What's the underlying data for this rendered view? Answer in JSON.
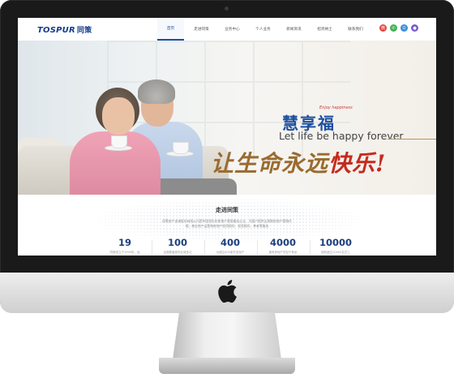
{
  "site": {
    "logo": "TOSPUR",
    "logo_cn": "同策"
  },
  "nav": {
    "items": [
      {
        "label": "首页",
        "active": true
      },
      {
        "label": "走进同策",
        "active": false
      },
      {
        "label": "业务中心",
        "active": false
      },
      {
        "label": "个人业务",
        "active": false
      },
      {
        "label": "新闻资讯",
        "active": false
      },
      {
        "label": "招贤纳士",
        "active": false
      },
      {
        "label": "联系我们",
        "active": false
      }
    ],
    "social_icons": [
      {
        "name": "weibo-icon",
        "color": "#e0453a",
        "glyph": "微"
      },
      {
        "name": "wechat-icon",
        "color": "#3fb34f",
        "glyph": "✆"
      },
      {
        "name": "qq-icon",
        "color": "#3a8ddb",
        "glyph": "Q"
      },
      {
        "name": "user-icon",
        "color": "#7b5cc9",
        "glyph": "●"
      }
    ]
  },
  "banner": {
    "brand_cn": "慧享福",
    "brand_script": "Enjoy happiness",
    "slogan_en": "Let life be happy forever",
    "slogan_cn_part1": "让生命永远",
    "slogan_cn_part2": "快乐!",
    "slide_count": 4,
    "active_slide": 3
  },
  "about": {
    "title": "走进同策",
    "description": "同策房产咨询股份有限公司是中国领先的房地产营销服务企业，为客户提供全周期房地产营销代理、商业地产运营和房地产投资顾问、投资顾问、养老等服务",
    "stats": [
      {
        "value": "19",
        "caption": "同策成立于1999年，经"
      },
      {
        "value": "100",
        "caption": "全国覆盖城市区域多达"
      },
      {
        "value": "400",
        "caption": "为超过400家开发商产"
      },
      {
        "value": "4000",
        "caption": "拥有房地产项目千条余"
      },
      {
        "value": "10000",
        "caption": "拥有超过10000名员工"
      }
    ]
  },
  "device": {
    "apple_logo": "apple-icon"
  }
}
